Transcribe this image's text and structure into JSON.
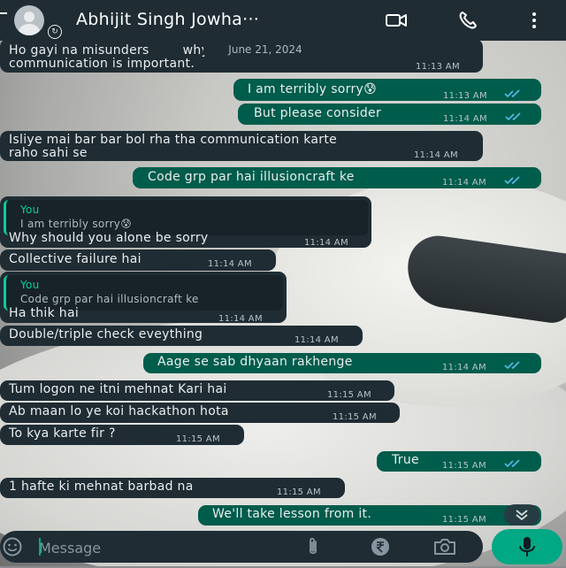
{
  "header": {
    "contact_name": "Abhijit Singh Jowha···",
    "icons": [
      "back-arrow-icon",
      "avatar",
      "video-call-icon",
      "voice-call-icon",
      "more-options-icon"
    ]
  },
  "date_chip": "June 21, 2024",
  "messages": [
    {
      "dir": "in",
      "text": "Ho gayi na misunders        why clear\ncommunication is important.",
      "time": "11:13 AM"
    },
    {
      "dir": "out",
      "text": "I am terribly sorry😰",
      "time": "11:13 AM",
      "status": "read"
    },
    {
      "dir": "out",
      "text": "But please consider",
      "time": "11:14 AM",
      "status": "read"
    },
    {
      "dir": "in",
      "text": "Isliye mai bar bar bol rha tha communication karte\nraho sahi se",
      "time": "11:14 AM"
    },
    {
      "dir": "out",
      "text": "Code grp par hai illusioncraft ke",
      "time": "11:14 AM",
      "status": "read"
    },
    {
      "dir": "in",
      "reply_to": {
        "author": "You",
        "text": "I am terribly sorry😰"
      },
      "text": "Why should you alone be sorry",
      "time": "11:14 AM"
    },
    {
      "dir": "in",
      "text": "Collective failure hai",
      "time": "11:14 AM"
    },
    {
      "dir": "in",
      "reply_to": {
        "author": "You",
        "text": "Code grp par hai illusioncraft ke"
      },
      "text": "Ha thik hai",
      "time": "11:14 AM"
    },
    {
      "dir": "in",
      "text": "Double/triple check eveything",
      "time": "11:14 AM"
    },
    {
      "dir": "out",
      "text": "Aage se sab dhyaan rakhenge",
      "time": "11:14 AM",
      "status": "read"
    },
    {
      "dir": "in",
      "text": "Tum logon ne itni mehnat Kari hai",
      "time": "11:15 AM"
    },
    {
      "dir": "in",
      "text": "Ab maan lo ye koi hackathon hota",
      "time": "11:15 AM"
    },
    {
      "dir": "in",
      "text": "To kya karte fir ?",
      "time": "11:15 AM"
    },
    {
      "dir": "out",
      "text": "True",
      "time": "11:15 AM",
      "status": "read"
    },
    {
      "dir": "in",
      "text": "1 hafte ki mehnat barbad na",
      "time": "11:15 AM"
    },
    {
      "dir": "out",
      "text": "We'll take lesson from it.",
      "time": "11:15 AM",
      "status": "read"
    }
  ],
  "composer": {
    "placeholder": "Message",
    "icons": [
      "emoji-icon",
      "attach-icon",
      "rupee-payment-icon",
      "camera-icon",
      "mic-icon"
    ]
  },
  "colors": {
    "header_bg": "#1f2c33",
    "incoming_bubble": "#1f2c33",
    "outgoing_bubble": "#005c4b",
    "read_tick": "#53bdeb",
    "accent": "#00a884"
  }
}
